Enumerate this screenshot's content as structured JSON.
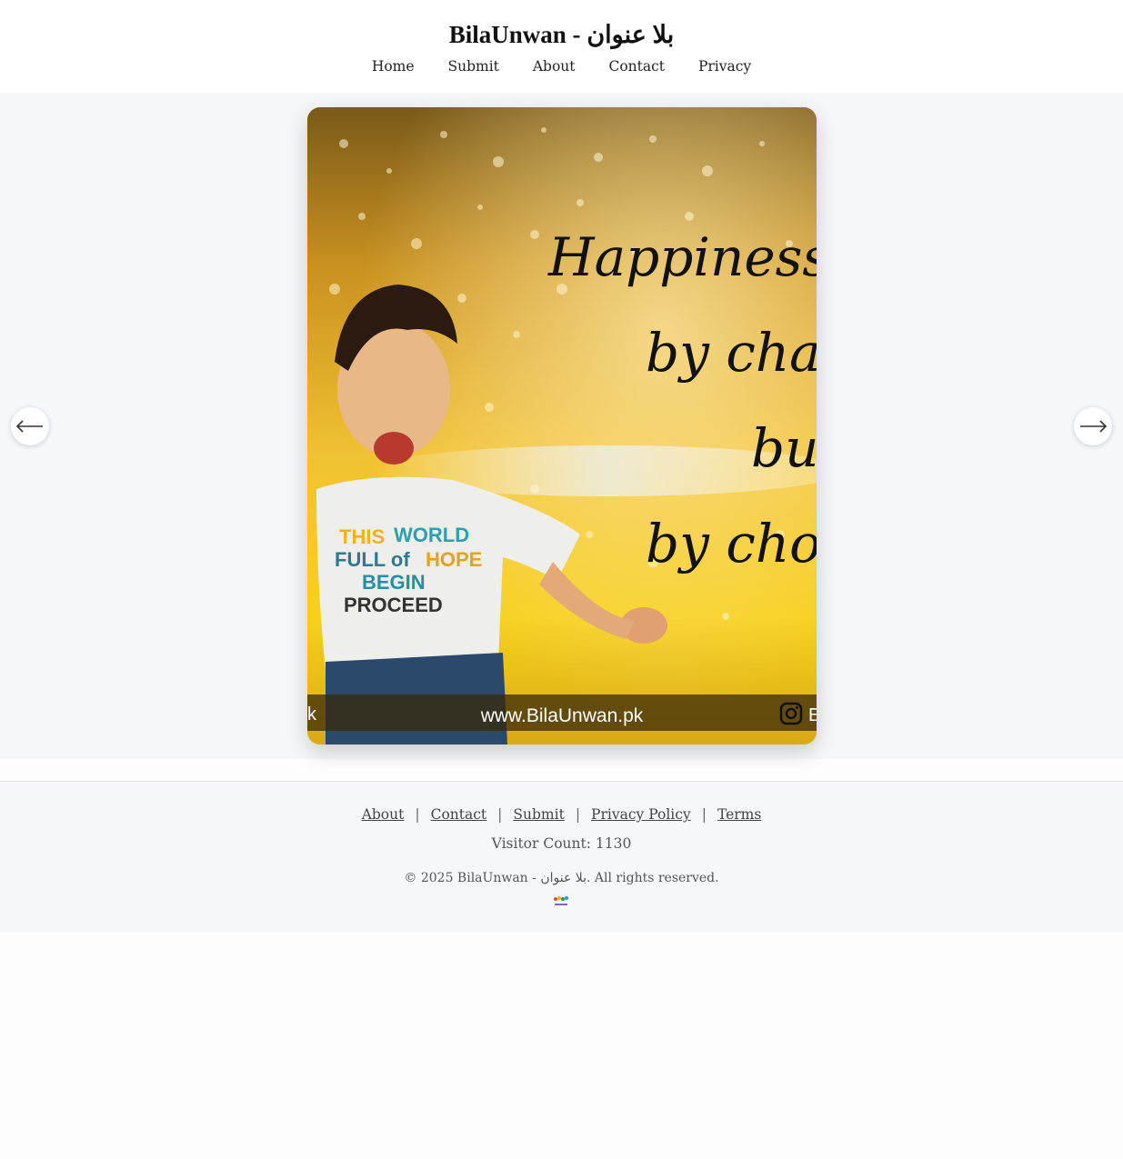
{
  "header": {
    "title": "BilaUnwan - بلا عنوان",
    "nav": [
      "Home",
      "Submit",
      "About",
      "Contact",
      "Privacy"
    ]
  },
  "slider": {
    "slide_lines": [
      "Happiness is",
      "by chanc",
      "but",
      "by choic"
    ],
    "watermark_url": "www.BilaUnwan.pk",
    "watermark_left": "k",
    "watermark_right": "E",
    "prev_icon": "arrow-left-icon",
    "next_icon": "arrow-right-icon",
    "prev_glyph": "⟵",
    "next_glyph": "⟶"
  },
  "footer": {
    "links": [
      "About",
      "Contact",
      "Submit",
      "Privacy Policy",
      "Terms"
    ],
    "separator": "|",
    "visitor_count": "Visitor Count: 1130",
    "copyright": "© 2025 BilaUnwan - بلا عنوان. All rights reserved.",
    "logo": "BilaUnwan"
  },
  "colors": {
    "page_bg": "#fdfdfd",
    "slider_bg": "#f6f7f9",
    "footer_bg": "#f6f7f9",
    "image_gold": "#e0a21a"
  }
}
